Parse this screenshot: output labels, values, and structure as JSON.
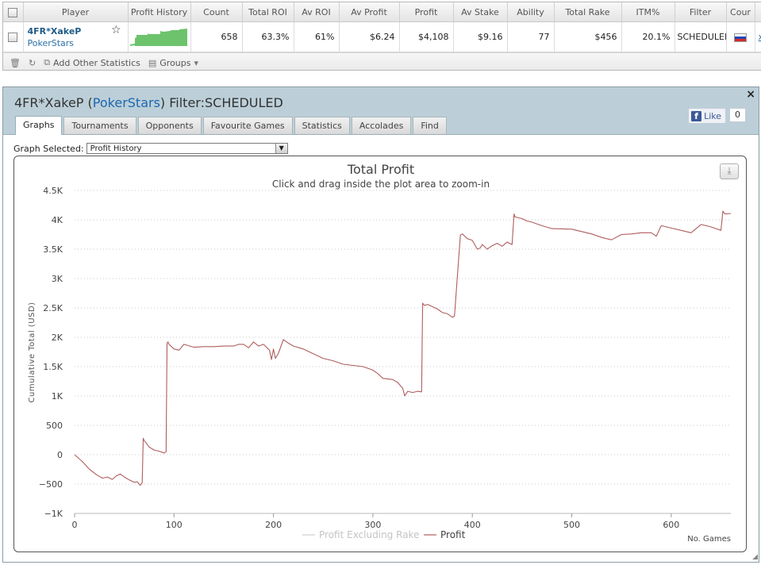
{
  "stats_table": {
    "headers": [
      "Player",
      "Profit History",
      "Count",
      "Total ROI",
      "Av ROI",
      "Av Profit",
      "Profit",
      "Av Stake",
      "Ability",
      "Total Rake",
      "ITM%",
      "Filter",
      "Cour"
    ],
    "row": {
      "player": "4FR*XakeP",
      "site": "PokerStars",
      "count": "658",
      "total_roi": "63.3%",
      "av_roi": "61%",
      "av_profit": "$6.24",
      "profit": "$4,108",
      "av_stake": "$9.16",
      "ability": "77",
      "total_rake": "$456",
      "itm": "20.1%",
      "filter": "SCHEDULED",
      "close_link": "x"
    },
    "toolbar": {
      "add_stats": "Add Other Statistics",
      "groups": "Groups"
    }
  },
  "panel": {
    "player": "4FR*XakeP",
    "site": "PokerStars",
    "filter_label": "Filter:SCHEDULED",
    "close": "×",
    "like_label": "Like",
    "like_count": "0",
    "tabs": [
      "Graphs",
      "Tournaments",
      "Opponents",
      "Favourite Games",
      "Statistics",
      "Accolades",
      "Find"
    ],
    "graph_selected_label": "Graph Selected:",
    "graph_selected_value": "Profit History"
  },
  "chart_data": {
    "type": "line",
    "title": "Total Profit",
    "subtitle": "Click and drag inside the plot area to zoom-in",
    "xlabel": "No. Games",
    "ylabel": "Cumulative Total (USD)",
    "xlim": [
      0,
      660
    ],
    "ylim": [
      -1000,
      4500
    ],
    "x_ticks": [
      0,
      100,
      200,
      300,
      400,
      500,
      600
    ],
    "y_ticks": [
      -1000,
      -500,
      0,
      500,
      1000,
      1500,
      2000,
      2500,
      3000,
      3500,
      4000,
      4500
    ],
    "y_tick_labels": [
      "−1K",
      "−500",
      "0",
      "500",
      "1K",
      "1.5K",
      "2K",
      "2.5K",
      "3K",
      "3.5K",
      "4K",
      "4.5K"
    ],
    "grid": true,
    "legend_position": "bottom-center",
    "series": [
      {
        "name": "Profit Excluding Rake",
        "color": "#cfcfcf",
        "x": [],
        "values": []
      },
      {
        "name": "Profit",
        "color": "#b05d5d",
        "x": [
          0,
          8,
          15,
          22,
          28,
          33,
          38,
          42,
          46,
          50,
          55,
          60,
          63,
          66,
          68,
          69,
          70,
          72,
          75,
          80,
          85,
          90,
          92,
          93,
          94,
          95,
          100,
          105,
          110,
          120,
          130,
          140,
          150,
          160,
          165,
          170,
          175,
          180,
          185,
          190,
          196,
          198,
          200,
          202,
          205,
          210,
          215,
          220,
          230,
          240,
          250,
          260,
          270,
          280,
          290,
          300,
          305,
          310,
          320,
          325,
          330,
          332,
          335,
          340,
          345,
          349,
          350,
          352,
          355,
          360,
          365,
          370,
          375,
          380,
          382,
          388,
          390,
          395,
          400,
          405,
          408,
          410,
          415,
          420,
          425,
          430,
          435,
          440,
          442,
          443,
          445,
          450,
          455,
          460,
          470,
          480,
          500,
          510,
          520,
          530,
          540,
          550,
          560,
          570,
          580,
          585,
          590,
          595,
          600,
          610,
          620,
          630,
          640,
          645,
          650,
          652,
          654,
          660
        ],
        "values": [
          0,
          -120,
          -250,
          -340,
          -400,
          -380,
          -420,
          -360,
          -330,
          -380,
          -430,
          -470,
          -460,
          -520,
          -480,
          280,
          240,
          200,
          130,
          80,
          60,
          30,
          50,
          1900,
          1920,
          1880,
          1800,
          1780,
          1880,
          1830,
          1840,
          1840,
          1850,
          1850,
          1880,
          1880,
          1820,
          1920,
          1850,
          1880,
          1780,
          1620,
          1800,
          1640,
          1730,
          1960,
          1900,
          1850,
          1800,
          1720,
          1640,
          1600,
          1540,
          1520,
          1500,
          1440,
          1380,
          1300,
          1280,
          1230,
          1130,
          1000,
          1080,
          1060,
          1080,
          1070,
          2580,
          2540,
          2560,
          2520,
          2480,
          2420,
          2400,
          2340,
          2360,
          3740,
          3760,
          3680,
          3650,
          3500,
          3520,
          3580,
          3500,
          3560,
          3600,
          3550,
          3620,
          3580,
          4100,
          4050,
          4040,
          4020,
          3980,
          3960,
          3900,
          3850,
          3840,
          3800,
          3760,
          3700,
          3660,
          3750,
          3760,
          3780,
          3780,
          3720,
          3900,
          3880,
          3860,
          3820,
          3780,
          3920,
          3880,
          3850,
          3820,
          4150,
          4100,
          4108
        ]
      }
    ]
  }
}
